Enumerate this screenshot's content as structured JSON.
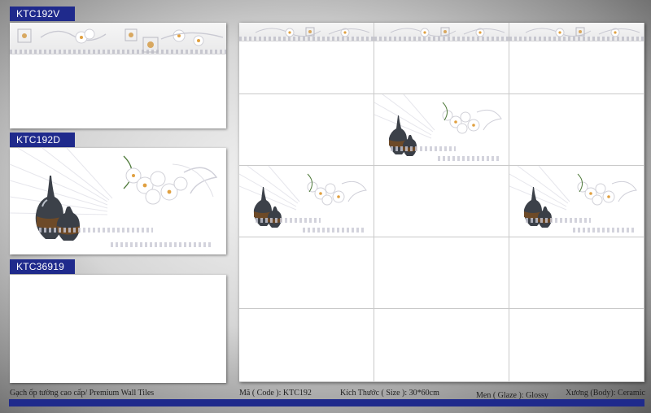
{
  "products": {
    "border_tile": "KTC192V",
    "decor_tile": "KTC192D",
    "plain_tile": "KTC36919"
  },
  "footer": {
    "category": "Gạch ốp tường cao cấp/ Premium Wall Tiles",
    "code": "Mã ( Code ): KTC192",
    "size": "Kích Thước ( Size ): 30*60cm",
    "glaze": "Men ( Glaze ): Glossy",
    "body": "Xương (Body): Ceramic"
  },
  "colors": {
    "label_bg": "#1f2a8c",
    "vase_dark": "#3a3f47",
    "vase_band": "#6b4a2a",
    "flower_center": "#e0a040"
  }
}
